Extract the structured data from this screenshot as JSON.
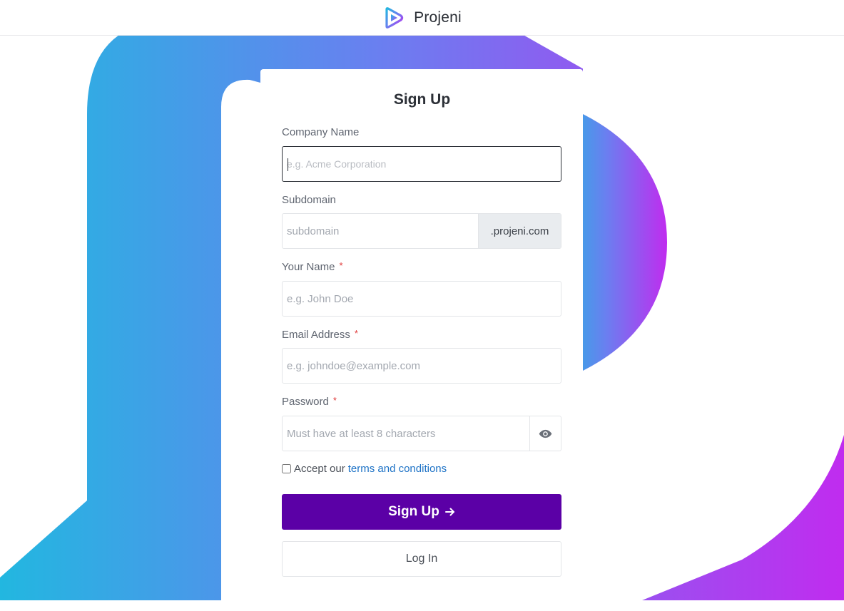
{
  "header": {
    "brand_name": "Projeni",
    "logo_icon": "projeni-logo"
  },
  "colors": {
    "gradient_start": "#22b7e0",
    "gradient_mid": "#6a7ff0",
    "gradient_end": "#c02cef",
    "primary_button": "#5b00a6",
    "link": "#1d72c6",
    "required": "#e03a3a"
  },
  "form": {
    "title": "Sign Up",
    "company": {
      "label": "Company Name",
      "placeholder": "e.g. Acme Corporation",
      "value": ""
    },
    "subdomain": {
      "label": "Subdomain",
      "placeholder": "subdomain",
      "suffix": ".projeni.com",
      "value": ""
    },
    "your_name": {
      "label": "Your Name",
      "required_mark": "*",
      "placeholder": "e.g. John Doe",
      "value": ""
    },
    "email": {
      "label": "Email Address",
      "required_mark": "*",
      "placeholder": "e.g. johndoe@example.com",
      "value": ""
    },
    "password": {
      "label": "Password",
      "required_mark": "*",
      "placeholder": "Must have at least 8 characters",
      "value": "",
      "toggle_icon": "eye-icon"
    },
    "terms": {
      "prefix": "Accept our",
      "link_text": "terms and conditions",
      "checked": false
    },
    "submit_label": "Sign Up",
    "submit_icon": "arrow-right-icon",
    "login_label": "Log In"
  }
}
